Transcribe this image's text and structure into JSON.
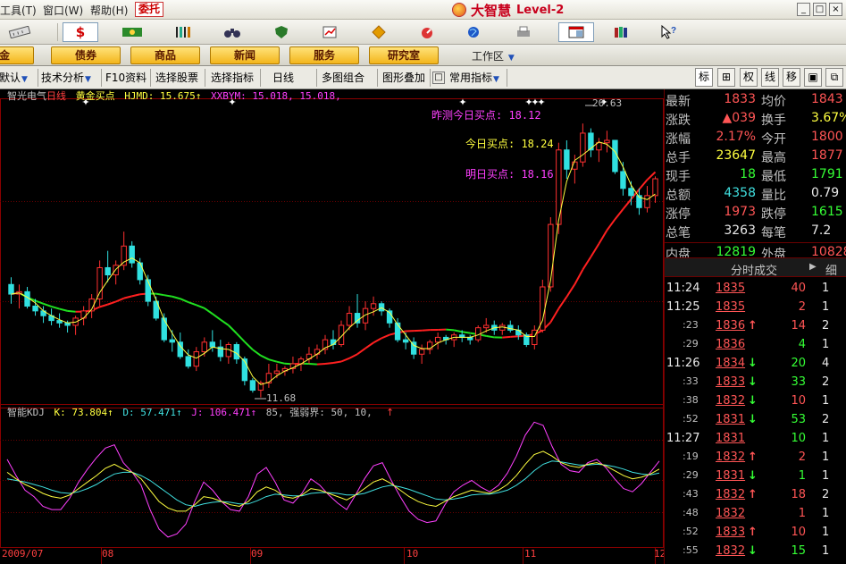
{
  "menu": {
    "items": [
      {
        "label": "工具(T)"
      },
      {
        "label": "窗口(W)"
      },
      {
        "label": "帮助(H)"
      }
    ],
    "trade_button": "委托"
  },
  "brand": {
    "name": "大智慧",
    "suffix": "Level-2"
  },
  "window_buttons": [
    "_",
    "□",
    "×"
  ],
  "toolbar": {
    "icons": [
      "ruler-icon",
      "dollar-icon",
      "money-flow-icon",
      "barcode-icon",
      "binoculars-icon",
      "shield-icon",
      "chart-flag-icon",
      "diamond-icon",
      "gauge-icon",
      "globe-icon",
      "print-icon",
      "window-layout-icon",
      "books-icon",
      "help-pointer-icon"
    ]
  },
  "navbar": {
    "buttons": [
      "基金",
      "债券",
      "商品",
      "新闻",
      "服务",
      "研究室"
    ],
    "workarea_label": "工作区"
  },
  "funcbar": {
    "items": [
      "默认",
      "技术分析",
      "F10资料",
      "选择股票",
      "选择指标",
      "日线",
      "多图组合",
      "图形叠加",
      "常用指标"
    ],
    "right_tabs": [
      "标",
      "⊞",
      "权",
      "线",
      "移",
      "▣",
      "⧉"
    ]
  },
  "chart": {
    "stock_name": "智光电气",
    "period": "日线",
    "main_indicator": "黄金买点",
    "hjmd_label": "HJMD:",
    "hjmd_value": "15.675↑",
    "xxbym_label": "XXBYM:",
    "xxbym_values": "15.018, 15.018,",
    "ann_yesterday": "昨测今日买点: 18.12",
    "ann_today": "今日买点: 18.24",
    "ann_tomorrow": "明日买点: 18.16",
    "high_label": "20.63",
    "low_label": "11.68",
    "sub_name": "智能KDJ",
    "k_text": "K: 73.804↑",
    "d_text": "D: 57.471↑",
    "j_text": "J: 106.471↑",
    "strong_text": "85, 强弱界: 50, 10,",
    "month_labels": [
      "2009/07",
      "08",
      "09",
      "10",
      "11",
      "12"
    ]
  },
  "chart_data": {
    "type": "candlestick",
    "candles": [
      {
        "o": 13.9,
        "h": 14.2,
        "l": 13.1,
        "c": 13.5
      },
      {
        "o": 13.5,
        "h": 13.9,
        "l": 12.9,
        "c": 13.6
      },
      {
        "o": 13.6,
        "h": 13.8,
        "l": 12.9,
        "c": 13.0
      },
      {
        "o": 13.0,
        "h": 13.3,
        "l": 12.6,
        "c": 12.8
      },
      {
        "o": 12.8,
        "h": 13.0,
        "l": 12.3,
        "c": 12.6
      },
      {
        "o": 12.6,
        "h": 12.9,
        "l": 12.2,
        "c": 12.4
      },
      {
        "o": 12.4,
        "h": 12.7,
        "l": 12.1,
        "c": 12.3
      },
      {
        "o": 12.3,
        "h": 12.4,
        "l": 11.9,
        "c": 12.2
      },
      {
        "o": 12.2,
        "h": 12.6,
        "l": 11.8,
        "c": 12.5
      },
      {
        "o": 12.5,
        "h": 13.0,
        "l": 12.2,
        "c": 12.8
      },
      {
        "o": 12.8,
        "h": 13.5,
        "l": 12.5,
        "c": 13.3
      },
      {
        "o": 13.3,
        "h": 14.9,
        "l": 13.0,
        "c": 14.6
      },
      {
        "o": 14.6,
        "h": 15.3,
        "l": 14.0,
        "c": 14.3
      },
      {
        "o": 14.3,
        "h": 14.9,
        "l": 13.9,
        "c": 14.7
      },
      {
        "o": 14.7,
        "h": 16.1,
        "l": 14.5,
        "c": 15.5
      },
      {
        "o": 15.5,
        "h": 15.7,
        "l": 14.6,
        "c": 14.8
      },
      {
        "o": 14.8,
        "h": 15.0,
        "l": 13.9,
        "c": 14.1
      },
      {
        "o": 14.1,
        "h": 14.3,
        "l": 13.0,
        "c": 13.2
      },
      {
        "o": 13.2,
        "h": 13.4,
        "l": 12.4,
        "c": 12.5
      },
      {
        "o": 12.5,
        "h": 12.7,
        "l": 11.5,
        "c": 11.6
      },
      {
        "o": 11.6,
        "h": 12.0,
        "l": 11.1,
        "c": 11.5
      },
      {
        "o": 11.5,
        "h": 11.9,
        "l": 10.8,
        "c": 10.9
      },
      {
        "o": 10.9,
        "h": 11.2,
        "l": 10.4,
        "c": 10.5
      },
      {
        "o": 10.5,
        "h": 11.3,
        "l": 10.3,
        "c": 11.1
      },
      {
        "o": 11.1,
        "h": 11.7,
        "l": 10.9,
        "c": 11.5
      },
      {
        "o": 11.5,
        "h": 12.0,
        "l": 11.1,
        "c": 11.3
      },
      {
        "o": 11.3,
        "h": 11.6,
        "l": 10.7,
        "c": 10.9
      },
      {
        "o": 10.9,
        "h": 11.5,
        "l": 10.6,
        "c": 11.4
      },
      {
        "o": 11.4,
        "h": 11.5,
        "l": 10.6,
        "c": 10.8
      },
      {
        "o": 10.8,
        "h": 10.9,
        "l": 9.7,
        "c": 9.9
      },
      {
        "o": 9.9,
        "h": 10.0,
        "l": 9.4,
        "c": 9.5
      },
      {
        "o": 9.5,
        "h": 9.9,
        "l": 9.2,
        "c": 9.8
      },
      {
        "o": 9.8,
        "h": 10.6,
        "l": 9.6,
        "c": 10.2
      },
      {
        "o": 10.2,
        "h": 10.6,
        "l": 10.0,
        "c": 10.3
      },
      {
        "o": 10.3,
        "h": 10.5,
        "l": 10.1,
        "c": 10.4
      },
      {
        "o": 10.4,
        "h": 10.9,
        "l": 10.2,
        "c": 10.6
      },
      {
        "o": 10.6,
        "h": 10.9,
        "l": 10.3,
        "c": 10.8
      },
      {
        "o": 10.8,
        "h": 11.3,
        "l": 10.6,
        "c": 11.0
      },
      {
        "o": 11.0,
        "h": 11.4,
        "l": 10.8,
        "c": 11.2
      },
      {
        "o": 11.2,
        "h": 11.8,
        "l": 11.0,
        "c": 11.6
      },
      {
        "o": 11.6,
        "h": 12.0,
        "l": 11.2,
        "c": 11.4
      },
      {
        "o": 11.4,
        "h": 12.4,
        "l": 11.3,
        "c": 12.2
      },
      {
        "o": 12.2,
        "h": 13.0,
        "l": 12.0,
        "c": 12.7
      },
      {
        "o": 12.7,
        "h": 13.5,
        "l": 12.1,
        "c": 12.3
      },
      {
        "o": 12.3,
        "h": 13.2,
        "l": 12.0,
        "c": 12.9
      },
      {
        "o": 12.9,
        "h": 13.4,
        "l": 12.6,
        "c": 13.1
      },
      {
        "o": 13.1,
        "h": 13.2,
        "l": 12.6,
        "c": 12.8
      },
      {
        "o": 12.8,
        "h": 12.9,
        "l": 12.1,
        "c": 12.3
      },
      {
        "o": 12.3,
        "h": 12.5,
        "l": 11.5,
        "c": 11.6
      },
      {
        "o": 11.6,
        "h": 11.9,
        "l": 11.2,
        "c": 11.5
      },
      {
        "o": 11.5,
        "h": 11.7,
        "l": 10.8,
        "c": 11.0
      },
      {
        "o": 11.0,
        "h": 11.4,
        "l": 10.6,
        "c": 11.2
      },
      {
        "o": 11.2,
        "h": 11.6,
        "l": 11.0,
        "c": 11.5
      },
      {
        "o": 11.5,
        "h": 11.9,
        "l": 11.2,
        "c": 11.7
      },
      {
        "o": 11.7,
        "h": 11.8,
        "l": 11.4,
        "c": 11.6
      },
      {
        "o": 11.6,
        "h": 11.9,
        "l": 11.3,
        "c": 11.8
      },
      {
        "o": 11.8,
        "h": 12.0,
        "l": 11.5,
        "c": 11.7
      },
      {
        "o": 11.7,
        "h": 11.8,
        "l": 11.4,
        "c": 11.6
      },
      {
        "o": 11.6,
        "h": 12.2,
        "l": 11.5,
        "c": 12.1
      },
      {
        "o": 12.1,
        "h": 12.5,
        "l": 11.9,
        "c": 12.2
      },
      {
        "o": 12.2,
        "h": 12.4,
        "l": 11.8,
        "c": 12.0
      },
      {
        "o": 12.0,
        "h": 12.3,
        "l": 11.8,
        "c": 12.2
      },
      {
        "o": 12.2,
        "h": 12.4,
        "l": 11.9,
        "c": 12.0
      },
      {
        "o": 12.0,
        "h": 12.2,
        "l": 11.6,
        "c": 11.8
      },
      {
        "o": 11.8,
        "h": 11.9,
        "l": 11.3,
        "c": 11.4
      },
      {
        "o": 11.4,
        "h": 12.2,
        "l": 11.2,
        "c": 12.0
      },
      {
        "o": 12.0,
        "h": 14.1,
        "l": 11.9,
        "c": 13.8
      },
      {
        "o": 13.8,
        "h": 16.7,
        "l": 13.6,
        "c": 16.4
      },
      {
        "o": 16.4,
        "h": 19.8,
        "l": 16.0,
        "c": 19.5
      },
      {
        "o": 19.5,
        "h": 19.9,
        "l": 18.3,
        "c": 18.7
      },
      {
        "o": 18.7,
        "h": 19.3,
        "l": 18.1,
        "c": 19.0
      },
      {
        "o": 19.0,
        "h": 20.6,
        "l": 18.8,
        "c": 20.2
      },
      {
        "o": 20.2,
        "h": 20.4,
        "l": 19.2,
        "c": 19.5
      },
      {
        "o": 19.5,
        "h": 20.0,
        "l": 19.0,
        "c": 19.8
      },
      {
        "o": 19.8,
        "h": 20.3,
        "l": 19.4,
        "c": 19.9
      },
      {
        "o": 19.9,
        "h": 19.9,
        "l": 18.5,
        "c": 18.6
      },
      {
        "o": 18.6,
        "h": 19.0,
        "l": 17.6,
        "c": 17.9
      },
      {
        "o": 17.9,
        "h": 18.2,
        "l": 17.2,
        "c": 17.6
      },
      {
        "o": 17.6,
        "h": 17.9,
        "l": 16.8,
        "c": 17.1
      },
      {
        "o": 17.1,
        "h": 18.0,
        "l": 16.9,
        "c": 17.6
      },
      {
        "o": 17.6,
        "h": 18.4,
        "l": 17.3,
        "c": 18.3
      }
    ],
    "kdj": {
      "k": [
        70,
        62,
        55,
        50,
        44,
        40,
        38,
        42,
        50,
        58,
        66,
        75,
        80,
        74,
        70,
        62,
        48,
        34,
        26,
        22,
        22,
        30,
        40,
        38,
        34,
        30,
        28,
        34,
        46,
        52,
        48,
        40,
        38,
        42,
        50,
        48,
        44,
        40,
        36,
        42,
        50,
        58,
        62,
        56,
        48,
        40,
        34,
        30,
        28,
        34,
        40,
        44,
        48,
        46,
        44,
        48,
        55,
        66,
        80,
        92,
        96,
        90,
        82,
        78,
        76,
        80,
        82,
        78,
        72,
        66,
        62,
        64,
        68,
        74
      ],
      "d": [
        62,
        60,
        58,
        55,
        52,
        48,
        45,
        44,
        46,
        50,
        55,
        62,
        68,
        70,
        70,
        66,
        60,
        52,
        44,
        36,
        30,
        28,
        31,
        33,
        34,
        33,
        31,
        31,
        35,
        40,
        43,
        42,
        41,
        41,
        44,
        45,
        45,
        44,
        42,
        42,
        44,
        48,
        52,
        54,
        52,
        49,
        45,
        41,
        37,
        36,
        37,
        39,
        42,
        43,
        43,
        45,
        48,
        54,
        62,
        72,
        80,
        84,
        83,
        81,
        79,
        79,
        80,
        79,
        77,
        74,
        70,
        68,
        67,
        69
      ],
      "j": [
        86,
        66,
        48,
        40,
        28,
        24,
        24,
        38,
        58,
        74,
        88,
        100,
        104,
        82,
        70,
        54,
        24,
        0,
        -10,
        -6,
        6,
        34,
        58,
        48,
        34,
        24,
        22,
        40,
        68,
        76,
        58,
        36,
        32,
        44,
        62,
        54,
        42,
        32,
        24,
        42,
        62,
        78,
        82,
        60,
        40,
        22,
        12,
        8,
        10,
        30,
        46,
        54,
        60,
        52,
        46,
        54,
        69,
        90,
        116,
        132,
        128,
        102,
        80,
        72,
        70,
        82,
        86,
        76,
        62,
        50,
        46,
        56,
        70,
        84
      ],
      "ylim": [
        -20,
        140
      ]
    },
    "ylim": [
      9.0,
      21.5
    ]
  },
  "quote": {
    "rows": [
      {
        "l1": "最新",
        "v1": "1833",
        "l2": "均价",
        "v2": "1843",
        "c1": "red",
        "c2": "red"
      },
      {
        "l1": "涨跌",
        "v1": "▲039",
        "l2": "换手",
        "v2": "3.67%",
        "c1": "red",
        "c2": "yellow"
      },
      {
        "l1": "涨幅",
        "v1": "2.17%",
        "l2": "今开",
        "v2": "1800",
        "c1": "red",
        "c2": "red"
      },
      {
        "l1": "总手",
        "v1": "23647",
        "l2": "最高",
        "v2": "1877",
        "c1": "yellow",
        "c2": "red"
      },
      {
        "l1": "现手",
        "v1": "18",
        "l2": "最低",
        "v2": "1791",
        "c1": "green",
        "c2": "green"
      },
      {
        "l1": "总额",
        "v1": "4358",
        "l2": "量比",
        "v2": "0.79",
        "c1": "cyan",
        "c2": "white"
      },
      {
        "l1": "涨停",
        "v1": "1973",
        "l2": "跌停",
        "v2": "1615",
        "c1": "red",
        "c2": "green"
      },
      {
        "l1": "总笔",
        "v1": "3263",
        "l2": "每笔",
        "v2": "7.2",
        "c1": "white",
        "c2": "white"
      },
      {
        "l1": "内盘",
        "v1": "12819",
        "l2": "外盘",
        "v2": "10828",
        "c1": "green",
        "c2": "red"
      }
    ],
    "ticks_title": "分时成交",
    "ticks_tab": "细",
    "ticks": [
      {
        "t": "11:24",
        "p": "1835",
        "a": "",
        "v": "40",
        "n": "1",
        "pc": "red",
        "vc": "red"
      },
      {
        "t": "11:25",
        "p": "1835",
        "a": "",
        "v": "2",
        "n": "1",
        "pc": "red",
        "vc": "red"
      },
      {
        "t": ":23",
        "p": "1836",
        "a": "↑",
        "v": "14",
        "n": "2",
        "pc": "red",
        "vc": "red"
      },
      {
        "t": ":29",
        "p": "1836",
        "a": "",
        "v": "4",
        "n": "1",
        "pc": "red",
        "vc": "green"
      },
      {
        "t": "11:26",
        "p": "1834",
        "a": "↓",
        "v": "20",
        "n": "4",
        "pc": "red",
        "vc": "green"
      },
      {
        "t": ":33",
        "p": "1833",
        "a": "↓",
        "v": "33",
        "n": "2",
        "pc": "red",
        "vc": "green"
      },
      {
        "t": ":38",
        "p": "1832",
        "a": "↓",
        "v": "10",
        "n": "1",
        "pc": "red",
        "vc": "red"
      },
      {
        "t": ":52",
        "p": "1831",
        "a": "↓",
        "v": "53",
        "n": "2",
        "pc": "red",
        "vc": "green"
      },
      {
        "t": "11:27",
        "p": "1831",
        "a": "",
        "v": "10",
        "n": "1",
        "pc": "red",
        "vc": "green"
      },
      {
        "t": ":19",
        "p": "1832",
        "a": "↑",
        "v": "2",
        "n": "1",
        "pc": "red",
        "vc": "red"
      },
      {
        "t": ":29",
        "p": "1831",
        "a": "↓",
        "v": "1",
        "n": "1",
        "pc": "red",
        "vc": "green"
      },
      {
        "t": ":43",
        "p": "1832",
        "a": "↑",
        "v": "18",
        "n": "2",
        "pc": "red",
        "vc": "red"
      },
      {
        "t": ":48",
        "p": "1832",
        "a": "",
        "v": "1",
        "n": "1",
        "pc": "red",
        "vc": "red"
      },
      {
        "t": ":52",
        "p": "1833",
        "a": "↑",
        "v": "10",
        "n": "1",
        "pc": "red",
        "vc": "red"
      },
      {
        "t": ":55",
        "p": "1832",
        "a": "↓",
        "v": "15",
        "n": "1",
        "pc": "red",
        "vc": "green"
      }
    ]
  }
}
